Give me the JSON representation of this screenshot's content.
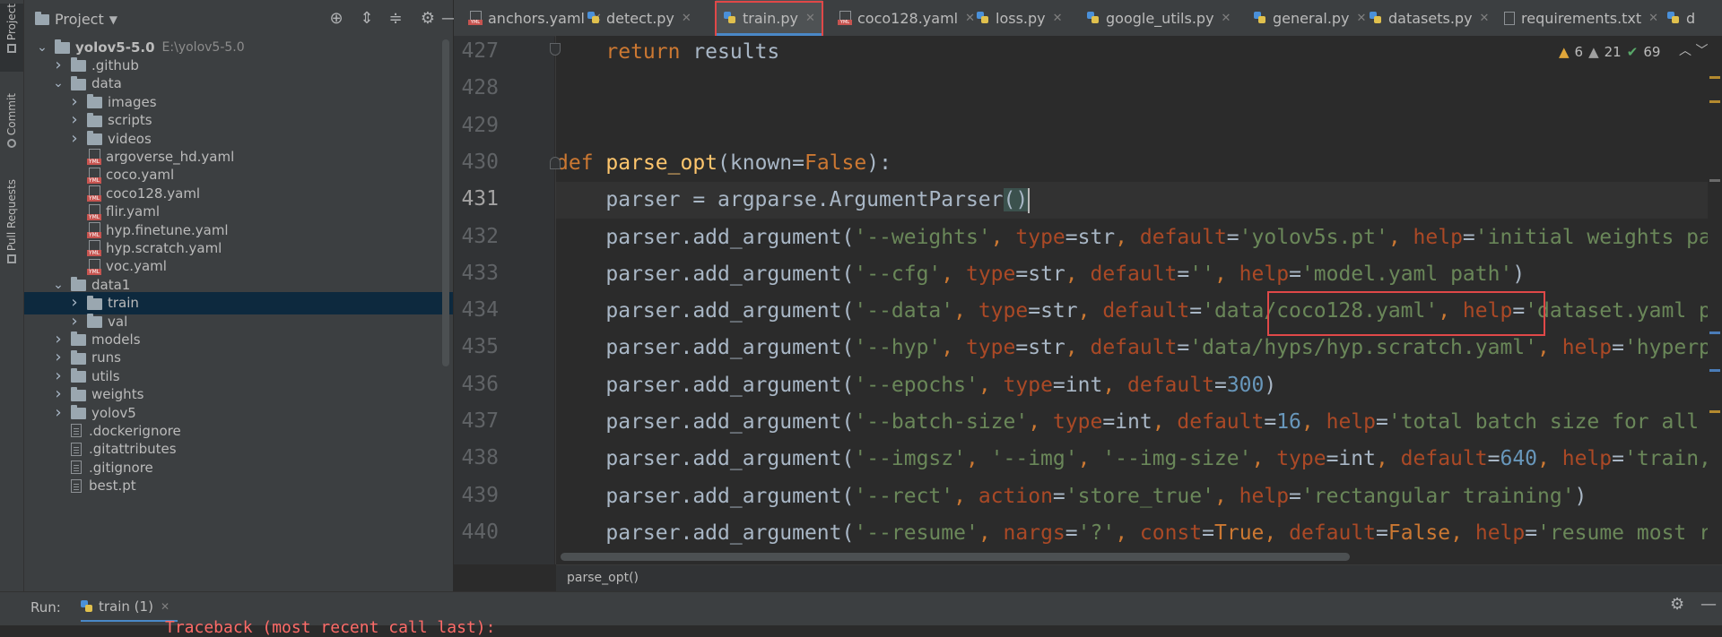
{
  "side_strip": {
    "tabs": [
      "Project",
      "Commit",
      "Pull Requests"
    ]
  },
  "project_panel": {
    "title": "Project",
    "header_icons": [
      "crosshair-icon",
      "expand-all-icon",
      "collapse-all-icon",
      "gear-icon",
      "minimize-icon"
    ],
    "tree": [
      {
        "name": "yolov5-5.0",
        "type": "root",
        "depth": 0,
        "open": true,
        "path": "E:\\yolov5-5.0"
      },
      {
        "name": ".github",
        "type": "folder",
        "depth": 1,
        "open": false
      },
      {
        "name": "data",
        "type": "folder",
        "depth": 1,
        "open": true
      },
      {
        "name": "images",
        "type": "folder",
        "depth": 2,
        "open": false
      },
      {
        "name": "scripts",
        "type": "folder",
        "depth": 2,
        "open": false
      },
      {
        "name": "videos",
        "type": "folder",
        "depth": 2,
        "open": false
      },
      {
        "name": "argoverse_hd.yaml",
        "type": "yaml",
        "depth": 2
      },
      {
        "name": "coco.yaml",
        "type": "yaml",
        "depth": 2
      },
      {
        "name": "coco128.yaml",
        "type": "yaml",
        "depth": 2
      },
      {
        "name": "flir.yaml",
        "type": "yaml",
        "depth": 2
      },
      {
        "name": "hyp.finetune.yaml",
        "type": "yaml",
        "depth": 2
      },
      {
        "name": "hyp.scratch.yaml",
        "type": "yaml",
        "depth": 2
      },
      {
        "name": "voc.yaml",
        "type": "yaml",
        "depth": 2
      },
      {
        "name": "data1",
        "type": "folder",
        "depth": 1,
        "open": true
      },
      {
        "name": "train",
        "type": "folder",
        "depth": 2,
        "open": false,
        "selected": true
      },
      {
        "name": "val",
        "type": "folder",
        "depth": 2,
        "open": false
      },
      {
        "name": "models",
        "type": "folder",
        "depth": 1,
        "open": false
      },
      {
        "name": "runs",
        "type": "folder",
        "depth": 1,
        "open": false
      },
      {
        "name": "utils",
        "type": "folder",
        "depth": 1,
        "open": false
      },
      {
        "name": "weights",
        "type": "folder",
        "depth": 1,
        "open": false
      },
      {
        "name": "yolov5",
        "type": "folder",
        "depth": 1,
        "open": false
      },
      {
        "name": ".dockerignore",
        "type": "file",
        "depth": 1
      },
      {
        "name": ".gitattributes",
        "type": "file",
        "depth": 1
      },
      {
        "name": ".gitignore",
        "type": "file",
        "depth": 1
      },
      {
        "name": "best.pt",
        "type": "file",
        "depth": 1
      }
    ]
  },
  "editor_tabs": [
    {
      "label": "anchors.yaml",
      "kind": "yaml"
    },
    {
      "label": "detect.py",
      "kind": "py"
    },
    {
      "label": "train.py",
      "kind": "py",
      "active": true
    },
    {
      "label": "coco128.yaml",
      "kind": "yaml"
    },
    {
      "label": "loss.py",
      "kind": "py"
    },
    {
      "label": "google_utils.py",
      "kind": "py"
    },
    {
      "label": "general.py",
      "kind": "py"
    },
    {
      "label": "datasets.py",
      "kind": "py"
    },
    {
      "label": "requirements.txt",
      "kind": "txt"
    },
    {
      "label": "d",
      "kind": "py"
    }
  ],
  "inspections": {
    "warnings": "6",
    "weak_warnings": "21",
    "ok": "69"
  },
  "code": {
    "current_line": 431,
    "lines": [
      {
        "n": "427",
        "tokens": [
          [
            "    ",
            ""
          ],
          [
            "return",
            "kw"
          ],
          [
            " results",
            ""
          ]
        ]
      },
      {
        "n": "428",
        "tokens": []
      },
      {
        "n": "429",
        "tokens": []
      },
      {
        "n": "430",
        "tokens": [
          [
            "def",
            "kw"
          ],
          [
            " ",
            ""
          ],
          [
            "parse_opt",
            "fn"
          ],
          [
            "(known=",
            ""
          ],
          [
            "False",
            "kw"
          ],
          [
            "):",
            ""
          ]
        ]
      },
      {
        "n": "431",
        "tokens": [
          [
            "    parser = argparse.ArgumentParser",
            ""
          ],
          [
            "()",
            "brace"
          ],
          [
            "",
            "cursor"
          ]
        ]
      },
      {
        "n": "432",
        "tokens": [
          [
            "    parser.add_argument(",
            ""
          ],
          [
            "'--weights'",
            "str"
          ],
          [
            ", ",
            "kw"
          ],
          [
            "type",
            "par"
          ],
          [
            "=str",
            ""
          ],
          [
            ", ",
            "kw"
          ],
          [
            "default",
            "par"
          ],
          [
            "=",
            ""
          ],
          [
            "'yolov5s.pt'",
            "str"
          ],
          [
            ", ",
            "kw"
          ],
          [
            "help",
            "par"
          ],
          [
            "=",
            ""
          ],
          [
            "'initial weights path'",
            "str"
          ],
          [
            ")",
            ""
          ]
        ]
      },
      {
        "n": "433",
        "tokens": [
          [
            "    parser.add_argument(",
            ""
          ],
          [
            "'--cfg'",
            "str"
          ],
          [
            ", ",
            "kw"
          ],
          [
            "type",
            "par"
          ],
          [
            "=str",
            ""
          ],
          [
            ", ",
            "kw"
          ],
          [
            "default",
            "par"
          ],
          [
            "=",
            ""
          ],
          [
            "''",
            "str"
          ],
          [
            ", ",
            "kw"
          ],
          [
            "help",
            "par"
          ],
          [
            "=",
            ""
          ],
          [
            "'model.yaml path'",
            "str"
          ],
          [
            ")",
            ""
          ]
        ]
      },
      {
        "n": "434",
        "tokens": [
          [
            "    parser.add_argument(",
            ""
          ],
          [
            "'--data'",
            "str"
          ],
          [
            ", ",
            "kw"
          ],
          [
            "type",
            "par"
          ],
          [
            "=str",
            ""
          ],
          [
            ", ",
            "kw"
          ],
          [
            "default",
            "par"
          ],
          [
            "=",
            ""
          ],
          [
            "'data/coco128.yaml'",
            "str"
          ],
          [
            ", ",
            "kw"
          ],
          [
            "help",
            "par"
          ],
          [
            "=",
            ""
          ],
          [
            "'dataset.yaml path'",
            "str"
          ],
          [
            ")",
            ""
          ]
        ]
      },
      {
        "n": "435",
        "tokens": [
          [
            "    parser.add_argument(",
            ""
          ],
          [
            "'--hyp'",
            "str"
          ],
          [
            ", ",
            "kw"
          ],
          [
            "type",
            "par"
          ],
          [
            "=str",
            ""
          ],
          [
            ", ",
            "kw"
          ],
          [
            "default",
            "par"
          ],
          [
            "=",
            ""
          ],
          [
            "'data/hyps/hyp.scratch.yaml'",
            "str"
          ],
          [
            ", ",
            "kw"
          ],
          [
            "help",
            "par"
          ],
          [
            "=",
            ""
          ],
          [
            "'hyperparameters path'",
            "str"
          ],
          [
            ")",
            ""
          ]
        ]
      },
      {
        "n": "436",
        "tokens": [
          [
            "    parser.add_argument(",
            ""
          ],
          [
            "'--epochs'",
            "str"
          ],
          [
            ", ",
            "kw"
          ],
          [
            "type",
            "par"
          ],
          [
            "=int",
            ""
          ],
          [
            ", ",
            "kw"
          ],
          [
            "default",
            "par"
          ],
          [
            "=",
            ""
          ],
          [
            "300",
            "num"
          ],
          [
            ")",
            ""
          ]
        ]
      },
      {
        "n": "437",
        "tokens": [
          [
            "    parser.add_argument(",
            ""
          ],
          [
            "'--batch-size'",
            "str"
          ],
          [
            ", ",
            "kw"
          ],
          [
            "type",
            "par"
          ],
          [
            "=int",
            ""
          ],
          [
            ", ",
            "kw"
          ],
          [
            "default",
            "par"
          ],
          [
            "=",
            ""
          ],
          [
            "16",
            "num"
          ],
          [
            ", ",
            "kw"
          ],
          [
            "help",
            "par"
          ],
          [
            "=",
            ""
          ],
          [
            "'total batch size for all GPUs'",
            "str"
          ],
          [
            ")",
            ""
          ]
        ]
      },
      {
        "n": "438",
        "tokens": [
          [
            "    parser.add_argument(",
            ""
          ],
          [
            "'--imgsz'",
            "str"
          ],
          [
            ", ",
            "kw"
          ],
          [
            "'--img'",
            "str"
          ],
          [
            ", ",
            "kw"
          ],
          [
            "'--img-size'",
            "str"
          ],
          [
            ", ",
            "kw"
          ],
          [
            "type",
            "par"
          ],
          [
            "=int",
            ""
          ],
          [
            ", ",
            "kw"
          ],
          [
            "default",
            "par"
          ],
          [
            "=",
            ""
          ],
          [
            "640",
            "num"
          ],
          [
            ", ",
            "kw"
          ],
          [
            "help",
            "par"
          ],
          [
            "=",
            ""
          ],
          [
            "'train, val image size (pixels)'",
            "str"
          ],
          [
            ")",
            ""
          ]
        ]
      },
      {
        "n": "439",
        "tokens": [
          [
            "    parser.add_argument(",
            ""
          ],
          [
            "'--rect'",
            "str"
          ],
          [
            ", ",
            "kw"
          ],
          [
            "action",
            "par"
          ],
          [
            "=",
            ""
          ],
          [
            "'store_true'",
            "str"
          ],
          [
            ", ",
            "kw"
          ],
          [
            "help",
            "par"
          ],
          [
            "=",
            ""
          ],
          [
            "'rectangular training'",
            "str"
          ],
          [
            ")",
            ""
          ]
        ]
      },
      {
        "n": "440",
        "tokens": [
          [
            "    parser.add_argument(",
            ""
          ],
          [
            "'--resume'",
            "str"
          ],
          [
            ", ",
            "kw"
          ],
          [
            "nargs",
            "par"
          ],
          [
            "=",
            ""
          ],
          [
            "'?'",
            "str"
          ],
          [
            ", ",
            "kw"
          ],
          [
            "const",
            "par"
          ],
          [
            "=",
            ""
          ],
          [
            "True",
            "kw"
          ],
          [
            ", ",
            "kw"
          ],
          [
            "default",
            "par"
          ],
          [
            "=",
            ""
          ],
          [
            "False",
            "kw"
          ],
          [
            ", ",
            "kw"
          ],
          [
            "help",
            "par"
          ],
          [
            "=",
            ""
          ],
          [
            "'resume most recent training'",
            "str"
          ],
          [
            ")",
            ""
          ]
        ]
      }
    ]
  },
  "breadcrumb": "parse_opt()",
  "run_bar": {
    "label": "Run:",
    "tab": "train (1)",
    "partial_output": "Traceback (most recent call last):"
  },
  "colors": {
    "keyword": "#cc7832",
    "function": "#ffc66d",
    "string": "#6a8759",
    "number": "#6897bb",
    "param": "#aa4926",
    "highlight_box": "#e04848",
    "selection": "#0d293e"
  }
}
